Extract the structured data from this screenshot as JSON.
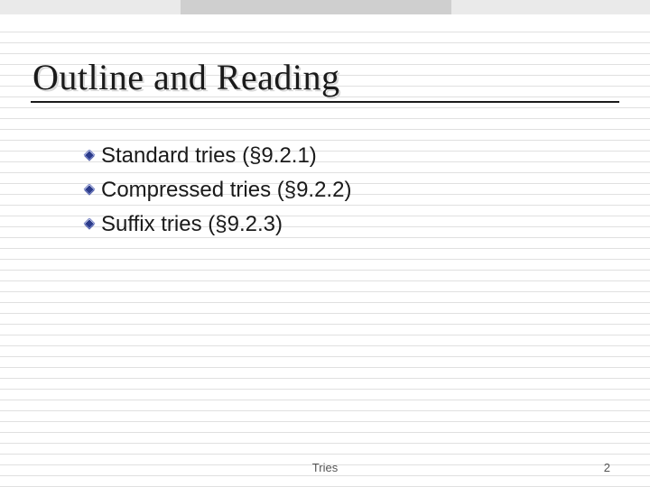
{
  "slide": {
    "title": "Outline and Reading",
    "bullets": [
      "Standard tries (§9.2.1)",
      "Compressed tries (§9.2.2)",
      "Suffix tries (§9.2.3)"
    ],
    "footer_title": "Tries",
    "page_number": "2"
  }
}
